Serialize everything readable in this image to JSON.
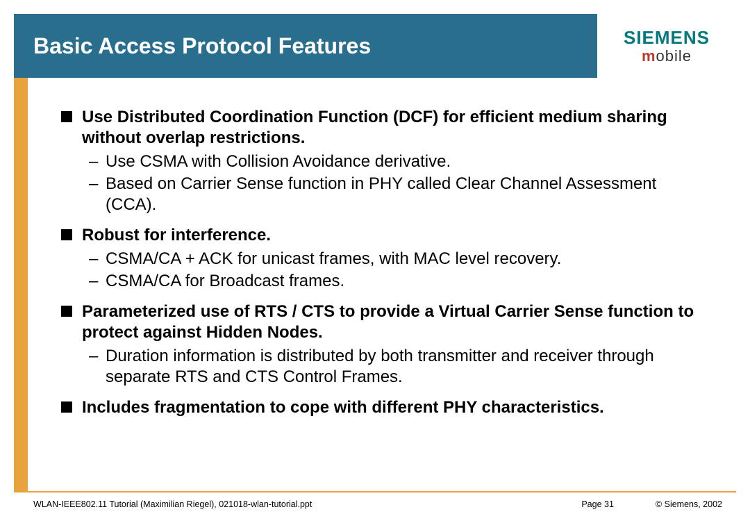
{
  "header": {
    "title": "Basic Access Protocol Features",
    "logo_top": "SIEMENS",
    "logo_bottom_m": "m",
    "logo_bottom_rest": "obile"
  },
  "content": {
    "b1": {
      "text": "Use Distributed Coordination Function (DCF) for efficient medium sharing without overlap restrictions.",
      "subs": [
        "Use CSMA with Collision Avoidance derivative.",
        "Based on Carrier Sense function in PHY called Clear Channel Assessment (CCA)."
      ]
    },
    "b2": {
      "text": "Robust for interference.",
      "subs": [
        "CSMA/CA + ACK for unicast frames,  with MAC level recovery.",
        "CSMA/CA for Broadcast frames."
      ]
    },
    "b3": {
      "text": "Parameterized use of RTS / CTS to provide a Virtual Carrier Sense function to protect against  Hidden Nodes.",
      "subs": [
        "Duration information is distributed by both transmitter and receiver through separate RTS and CTS Control Frames."
      ]
    },
    "b4": {
      "text": "Includes fragmentation to cope with different PHY characteristics.",
      "subs": []
    }
  },
  "footer": {
    "left": "WLAN-IEEE802.11 Tutorial (Maximilian Riegel), 021018-wlan-tutorial.ppt",
    "page": "Page 31",
    "right": "© Siemens, 2002"
  }
}
